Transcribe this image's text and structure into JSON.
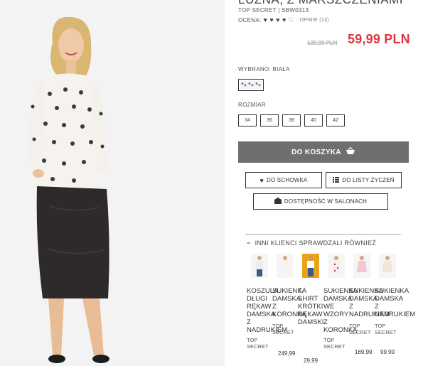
{
  "product": {
    "title": "LUŹNA, Z MARSZCZENIAMI",
    "sku": "TOP SECRET | SBW0313",
    "rating_label": "OCENA:",
    "hearts": "♥ ♥ ♥ ♥ ♡",
    "reviews": "OPINIE (13)",
    "old_price": "129,99 PLN",
    "price": "59,99 PLN",
    "selected_label": "WYBRANO: BIAŁA",
    "size_label": "ROZMIAR",
    "sizes": [
      "34",
      "36",
      "38",
      "40",
      "42"
    ]
  },
  "actions": {
    "add_to_cart": "DO KOSZYKA",
    "wishlist": "DO SCHOWKA",
    "gift_list": "DO LISTY ŻYCZEŃ",
    "availability": "DOSTĘPNOŚĆ W SALONACH"
  },
  "recommended": {
    "heading": "INNI KLIENCI SPRAWDZALI RÓWNIEŻ",
    "items": [
      {
        "name": "KOSZULA DŁUGI RĘKAW DAMSKA Z NADRUKIEM",
        "brand": "TOP SECRET",
        "price": ""
      },
      {
        "name": "SUKIENKA DAMSKA Z KORONKĄ",
        "brand": "TOP SECRET",
        "price": "249,99"
      },
      {
        "name": "T-SHIRT KRÓTKI RĘKAW DAMSKI",
        "brand": "TOP SECRET",
        "price": "29,99"
      },
      {
        "name": "SUKIENKA DAMSKA WE WZORY Z KORONKĄ",
        "brand": "TOP SECRET",
        "price": ""
      },
      {
        "name": "SUKIENKA DAMSKA Z NADRUKIEM",
        "brand": "TOP SECRET",
        "price": "169,99"
      },
      {
        "name": "SUKIENKA DAMSKA Z NADRUKIEM",
        "brand": "TOP SECRET",
        "price": "99,99"
      }
    ]
  },
  "colors": {
    "price": "#d9393e",
    "cart_button": "#6f6f6f"
  },
  "icons": [
    "basket-icon",
    "heart-icon",
    "list-icon",
    "store-icon",
    "minus-icon"
  ]
}
